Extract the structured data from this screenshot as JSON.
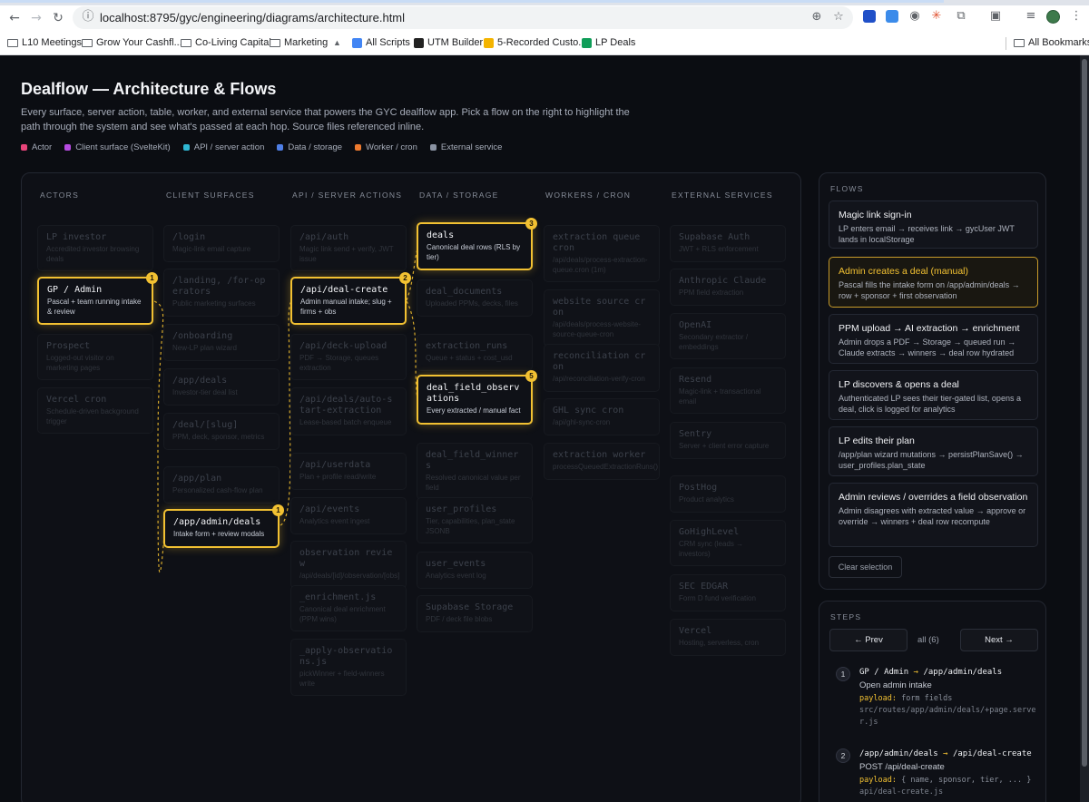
{
  "browser": {
    "url": "localhost:8795/gyc/engineering/diagrams/architecture.html",
    "bookmarks": [
      "L10 Meetings",
      "Grow Your Cashfl...",
      "Co-Living Capital",
      "Marketing",
      "All Scripts",
      "UTM Builder",
      "5-Recorded Custo...",
      "LP Deals"
    ],
    "all_bookmarks": "All Bookmarks"
  },
  "page": {
    "title": "Dealflow — Architecture & Flows",
    "description": "Every surface, server action, table, worker, and external service that powers the GYC dealflow app. Pick a flow on the right to highlight the path through the system and see what's passed at each hop. Source files referenced inline."
  },
  "legend": [
    {
      "label": "Actor",
      "color": "#e8457a"
    },
    {
      "label": "Client surface (SvelteKit)",
      "color": "#b64be0"
    },
    {
      "label": "API / server action",
      "color": "#2fb7d3"
    },
    {
      "label": "Data / storage",
      "color": "#4f7fe6"
    },
    {
      "label": "Worker / cron",
      "color": "#ee7a2f"
    },
    {
      "label": "External service",
      "color": "#8b93a3"
    }
  ],
  "columns": [
    "ACTORS",
    "CLIENT SURFACES",
    "API / SERVER ACTIONS",
    "DATA / STORAGE",
    "WORKERS / CRON",
    "EXTERNAL SERVICES"
  ],
  "nodes": {
    "actors": [
      {
        "title": "LP investor",
        "sub": "Accredited investor browsing deals"
      },
      {
        "title": "GP / Admin",
        "sub": "Pascal + team running intake & review",
        "badge": "1"
      },
      {
        "title": "Prospect",
        "sub": "Logged-out visitor on marketing pages"
      },
      {
        "title": "Vercel cron",
        "sub": "Schedule-driven background trigger"
      }
    ],
    "client": [
      {
        "title": "/login",
        "sub": "Magic-link email capture"
      },
      {
        "title": "/landing, /for-operators",
        "sub": "Public marketing surfaces"
      },
      {
        "title": "/onboarding",
        "sub": "New-LP plan wizard"
      },
      {
        "title": "/app/deals",
        "sub": "Investor-tier deal list"
      },
      {
        "title": "/deal/[slug]",
        "sub": "PPM, deck, sponsor, metrics"
      },
      {
        "title": "/app/plan",
        "sub": "Personalized cash-flow plan"
      },
      {
        "title": "/app/admin/deals",
        "sub": "Intake form + review modals",
        "badge": "1"
      }
    ],
    "api": [
      {
        "title": "/api/auth",
        "sub": "Magic link send + verify, JWT issue"
      },
      {
        "title": "/api/deal-create",
        "sub": "Admin manual intake; slug + firms + obs",
        "badge": "2"
      },
      {
        "title": "/api/deck-upload",
        "sub": "PDF → Storage, queues extraction"
      },
      {
        "title": "/api/deals/auto-start-extraction",
        "sub": "Lease-based batch enqueue"
      },
      {
        "title": "/api/userdata",
        "sub": "Plan + profile read/write"
      },
      {
        "title": "/api/events",
        "sub": "Analytics event ingest"
      },
      {
        "title": "observation review",
        "sub": "/api/deals/[id]/observation/[obs]"
      },
      {
        "title": "_enrichment.js",
        "sub": "Canonical deal enrichment (PPM wins)"
      },
      {
        "title": "_apply-observations.js",
        "sub": "pickWinner + field-winners write"
      }
    ],
    "data": [
      {
        "title": "deals",
        "sub": "Canonical deal rows (RLS by tier)",
        "badge": "3"
      },
      {
        "title": "deal_documents",
        "sub": "Uploaded PPMs, decks, files"
      },
      {
        "title": "extraction_runs",
        "sub": "Queue + status + cost_usd"
      },
      {
        "title": "deal_field_observations",
        "sub": "Every extracted / manual fact",
        "badge": "5"
      },
      {
        "title": "deal_field_winners",
        "sub": "Resolved canonical value per field"
      },
      {
        "title": "user_profiles",
        "sub": "Tier, capabilities, plan_state JSONB"
      },
      {
        "title": "user_events",
        "sub": "Analytics event log"
      },
      {
        "title": "Supabase Storage",
        "sub": "PDF / deck file blobs"
      }
    ],
    "workers": [
      {
        "title": "extraction queue cron",
        "sub": "/api/deals/process-extraction-queue.cron (1m)"
      },
      {
        "title": "website source cron",
        "sub": "/api/deals/process-website-source-queue-cron"
      },
      {
        "title": "reconciliation cron",
        "sub": "/api/reconciliation-verify-cron"
      },
      {
        "title": "GHL sync cron",
        "sub": "/api/ghl-sync-cron"
      },
      {
        "title": "extraction worker",
        "sub": "processQueuedExtractionRuns()"
      }
    ],
    "external": [
      {
        "title": "Supabase Auth",
        "sub": "JWT + RLS enforcement"
      },
      {
        "title": "Anthropic Claude",
        "sub": "PPM field extraction"
      },
      {
        "title": "OpenAI",
        "sub": "Secondary extractor / embeddings"
      },
      {
        "title": "Resend",
        "sub": "Magic-link + transactional email"
      },
      {
        "title": "Sentry",
        "sub": "Server + client error capture"
      },
      {
        "title": "PostHog",
        "sub": "Product analytics"
      },
      {
        "title": "GoHighLevel",
        "sub": "CRM sync (leads → investors)"
      },
      {
        "title": "SEC EDGAR",
        "sub": "Form D fund verification"
      },
      {
        "title": "Vercel",
        "sub": "Hosting, serverless, cron"
      }
    ]
  },
  "flows_panel": {
    "heading": "FLOWS",
    "flows": [
      {
        "title": "Magic link sign-in",
        "desc": "LP enters email → receives link → gycUser JWT lands in localStorage"
      },
      {
        "title": "Admin creates a deal (manual)",
        "desc": "Pascal fills the intake form on /app/admin/deals → row + sponsor + first observation"
      },
      {
        "title": "PPM upload → AI extraction → enrichment",
        "desc": "Admin drops a PDF → Storage → queued run → Claude extracts → winners → deal row hydrated"
      },
      {
        "title": "LP discovers & opens a deal",
        "desc": "Authenticated LP sees their tier-gated list, opens a deal, click is logged for analytics"
      },
      {
        "title": "LP edits their plan",
        "desc": "/app/plan wizard mutations → persistPlanSave() → user_profiles.plan_state"
      },
      {
        "title": "Admin reviews / overrides a field observation",
        "desc": "Admin disagrees with extracted value → approve or override → winners + deal row recompute"
      }
    ],
    "clear_label": "Clear selection"
  },
  "steps_panel": {
    "heading": "STEPS",
    "prev_label": "← Prev",
    "count_label": "all (6)",
    "next_label": "Next →",
    "steps": [
      {
        "num": "1",
        "from": "GP / Admin",
        "to": "/app/admin/deals",
        "action": "Open admin intake",
        "payload_label": "payload:",
        "payload": "form fields",
        "file": "src/routes/app/admin/deals/+page.server.js"
      },
      {
        "num": "2",
        "from": "/app/admin/deals",
        "to": "/api/deal-create",
        "action": "POST /api/deal-create",
        "payload_label": "payload:",
        "payload": "{ name, sponsor, tier, ... }",
        "file": "api/deal-create.js"
      }
    ]
  }
}
